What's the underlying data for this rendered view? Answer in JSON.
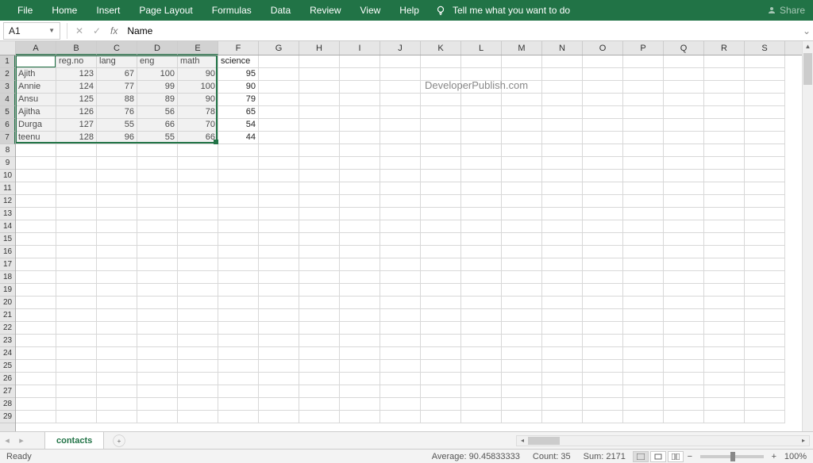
{
  "ribbon": {
    "tabs": [
      "File",
      "Home",
      "Insert",
      "Page Layout",
      "Formulas",
      "Data",
      "Review",
      "View",
      "Help"
    ],
    "tell_me": "Tell me what you want to do",
    "share": "Share"
  },
  "name_box": "A1",
  "formula_value": "Name",
  "columns": [
    "A",
    "B",
    "C",
    "D",
    "E",
    "F",
    "G",
    "H",
    "I",
    "J",
    "K",
    "L",
    "M",
    "N",
    "O",
    "P",
    "Q",
    "R",
    "S"
  ],
  "visible_rows": 29,
  "selection": {
    "rows": [
      1,
      7
    ],
    "cols": [
      1,
      5
    ],
    "active_row": 1,
    "active_col": 1
  },
  "data": {
    "headers": [
      "Name",
      "reg.no",
      "lang",
      "eng",
      "math",
      "science"
    ],
    "rows": [
      {
        "name": "Ajith",
        "reg": 123,
        "lang": 67,
        "eng": 100,
        "math": 90,
        "sci": 95
      },
      {
        "name": "Annie",
        "reg": 124,
        "lang": 77,
        "eng": 99,
        "math": 100,
        "sci": 90
      },
      {
        "name": "Ansu",
        "reg": 125,
        "lang": 88,
        "eng": 89,
        "math": 90,
        "sci": 79
      },
      {
        "name": "Ajitha",
        "reg": 126,
        "lang": 76,
        "eng": 56,
        "math": 78,
        "sci": 65
      },
      {
        "name": "Durga",
        "reg": 127,
        "lang": 55,
        "eng": 66,
        "math": 70,
        "sci": 54
      },
      {
        "name": "teenu",
        "reg": 128,
        "lang": 96,
        "eng": 55,
        "math": 66,
        "sci": 44
      }
    ]
  },
  "watermark": "DeveloperPublish.com",
  "sheet": {
    "active": "contacts"
  },
  "status": {
    "ready": "Ready",
    "avg_label": "Average:",
    "avg": "90.45833333",
    "count_label": "Count:",
    "count": "35",
    "sum_label": "Sum:",
    "sum": "2171",
    "zoom": "100%"
  }
}
